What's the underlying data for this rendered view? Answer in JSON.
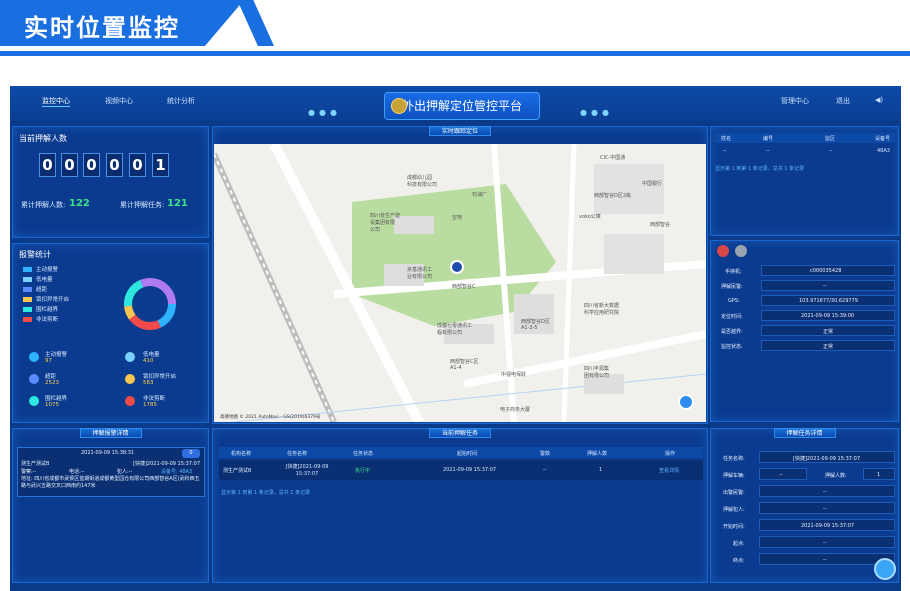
{
  "header": {
    "title": "实时位置监控"
  },
  "topbar": {
    "nav": [
      "监控中心",
      "视频中心",
      "统计分析"
    ],
    "title": "外出押解定位管控平台",
    "right": [
      "管理中心",
      "退出"
    ]
  },
  "count_panel": {
    "title": "当前押解人数",
    "digits": [
      "0",
      "0",
      "0",
      "0",
      "0",
      "1"
    ],
    "total_people_label": "累计押解人数:",
    "total_people": "122",
    "total_tasks_label": "累计押解任务:",
    "total_tasks": "121"
  },
  "alarm_panel": {
    "title": "报警统计",
    "legend": [
      {
        "label": "主动报警",
        "color": "#2fb2ff"
      },
      {
        "label": "低电量",
        "color": "#7ad0ff"
      },
      {
        "label": "超距",
        "color": "#5a8cff"
      },
      {
        "label": "锁扣异常开启",
        "color": "#f5c552"
      },
      {
        "label": "围栏越界",
        "color": "#2ee8e0"
      },
      {
        "label": "非法剪断",
        "color": "#f04a4a"
      }
    ],
    "stats": [
      {
        "label": "主动报警",
        "value": "97",
        "color": "#2fb2ff"
      },
      {
        "label": "低电量",
        "value": "410",
        "color": "#7ad0ff"
      },
      {
        "label": "超距",
        "value": "2523",
        "color": "#5a8cff"
      },
      {
        "label": "锁扣异常开启",
        "value": "583",
        "color": "#f5c552"
      },
      {
        "label": "围栏越界",
        "value": "1075",
        "color": "#2ee8e0"
      },
      {
        "label": "非法剪断",
        "value": "1785",
        "color": "#f04a4a"
      }
    ]
  },
  "map_panel": {
    "title": "实时跟踪定位",
    "labels": [
      "成都幼儿园",
      "科技有限公司",
      "四川省生产建",
      "设集团有限",
      "公司",
      "石油厂",
      "空地",
      "京基通讯工",
      "业有限公司",
      "西部智谷C",
      "口区-中",
      "口",
      "西部智谷D区2栋",
      "西部智谷",
      "中国银行",
      "voko公寓",
      "成都七零通讯工",
      "程有限公司",
      "西部智谷D区",
      "A1-3-5",
      "西部智谷C区",
      "A1-4",
      "中视电保跃",
      "电子商务大厦",
      "四川省新大数据",
      "科学应用研究院",
      "西部智谷A区",
      "四川丰源集",
      "团有限公司",
      "CIC-中国通"
    ],
    "copyright": "高德地图 © 2021 AutoNavi - GS(2019)6379号"
  },
  "device_table": {
    "headers": [
      "姓名",
      "编号",
      "监区",
      "设备号"
    ],
    "row": [
      "--",
      "--",
      "--",
      "48A3"
    ],
    "pager": "显示第 1 到第 1 条记录，总共 1 条记录"
  },
  "person_info": {
    "rows": [
      {
        "label": "手持机:",
        "value": "c000035428"
      },
      {
        "label": "押解民警:",
        "value": "--"
      },
      {
        "label": "GPS:",
        "value": "103.971677/30.629779"
      },
      {
        "label": "定位时间:",
        "value": "2021-09-09 15:39:00"
      },
      {
        "label": "是否越界:",
        "value": "正常"
      },
      {
        "label": "监控状态:",
        "value": "正常"
      }
    ]
  },
  "alarm_detail": {
    "title": "押解报警详情",
    "time": "2021-09-09 15:38:31",
    "badge": "0",
    "name": "测生产测试B",
    "task": "[快捷]2021-09-09 15:37:07",
    "phone_label": "警察:--",
    "tel_label": "电话:--",
    "person_label": "犯人:--",
    "device": "设备号: 48A3",
    "address": "地址: 四川省成都市武侯区蓝期街道成都黄型园仓有限公司西部智谷A区(武科西五路与武兴五路交叉口西南约147米"
  },
  "task_table": {
    "title": "当前押解任务",
    "headers": [
      "机构名称",
      "任务名称",
      "任务状态",
      "起始时间",
      "警数",
      "押解人数",
      "操作"
    ],
    "row": [
      "测生产测试B",
      "[快捷]2021-09-09 15:37:07",
      "执行中",
      "2021-09-09 15:37:07",
      "--",
      "1",
      "查看详情"
    ],
    "pager": "显示第 1 到第 1 条记录，总共 1 条记录"
  },
  "task_detail": {
    "title": "押解任务详情",
    "rows": [
      {
        "label": "任务名称:",
        "value": "[快捷]2021-09-09 15:37:07"
      },
      {
        "label": "押解车辆:",
        "value": "--",
        "label2": "押解人数:",
        "value2": "1"
      },
      {
        "label": "出警民警:",
        "value": "--"
      },
      {
        "label": "押解犯人:",
        "value": "--"
      },
      {
        "label": "开始时间:",
        "value": "2021-09-09 15:37:07"
      },
      {
        "label": "起点:",
        "value": "--"
      },
      {
        "label": "终点:",
        "value": "--"
      }
    ]
  },
  "colors": {
    "accent": "#1a6fe0",
    "panel": "#0b3b8f",
    "green": "#3de08a",
    "yellow": "#ffd24a"
  }
}
